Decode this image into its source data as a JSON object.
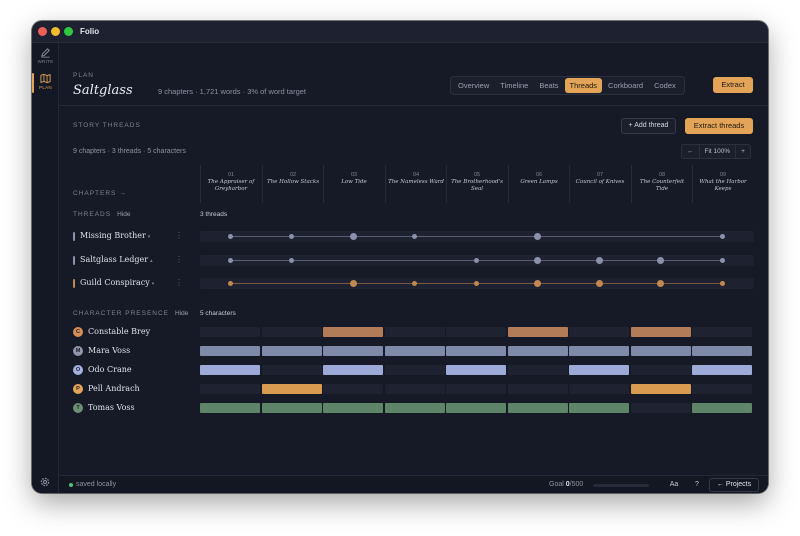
{
  "app": {
    "title": "Folio"
  },
  "rail": {
    "items": [
      {
        "label": "WRITE",
        "icon": "pencil-icon"
      },
      {
        "label": "PLAN",
        "icon": "map-icon"
      }
    ],
    "settings_icon": "gear-icon"
  },
  "header": {
    "section": "PLAN",
    "project": "Saltglass",
    "meta": "9 chapters · 1,721 words · 3% of word target",
    "tabs": [
      "Overview",
      "Timeline",
      "Beats",
      "Threads",
      "Corkboard",
      "Codex"
    ],
    "active_tab": "Threads",
    "extract_label": "Extract"
  },
  "threads_view": {
    "section_title": "STORY THREADS",
    "add_thread_label": "+ Add thread",
    "extract_threads_label": "Extract threads",
    "summary": "9 chapters · 3 threads · 5 characters",
    "zoom": {
      "prev": "←",
      "label": "Fit 100%",
      "next": "+"
    },
    "chapters_label": "CHAPTERS →",
    "chapters": [
      {
        "num": "01",
        "title": "The Appraiser of Greyharbor"
      },
      {
        "num": "02",
        "title": "The Hollow Stacks"
      },
      {
        "num": "03",
        "title": "Low Tide"
      },
      {
        "num": "04",
        "title": "The Nameless Ward"
      },
      {
        "num": "05",
        "title": "The Brotherhood's Seal"
      },
      {
        "num": "06",
        "title": "Green Lamps"
      },
      {
        "num": "07",
        "title": "Council of Knives"
      },
      {
        "num": "08",
        "title": "The Counterfeit Tide"
      },
      {
        "num": "09",
        "title": "What the Harbor Keeps"
      }
    ],
    "threads_label": "THREADS",
    "threads_hide": "Hide",
    "threads_count": "3 threads",
    "threads": [
      {
        "name": "Missing Brother",
        "caret": "▾",
        "more": "⋮",
        "color": "#8a91ab",
        "appearances": [
          0,
          1,
          2,
          3,
          5,
          8
        ],
        "major": [
          2,
          5
        ]
      },
      {
        "name": "Saltglass Ledger",
        "caret": "▴",
        "more": "⋮",
        "color": "#8a91ab",
        "appearances": [
          0,
          1,
          4,
          5,
          6,
          7,
          8
        ],
        "major": [
          5,
          6,
          7
        ]
      },
      {
        "name": "Guild Conspiracy",
        "caret": "▾",
        "more": "⋮",
        "color": "#c2884f",
        "appearances": [
          0,
          2,
          3,
          4,
          5,
          6,
          7,
          8
        ],
        "major": [
          2,
          5,
          6,
          7
        ]
      }
    ],
    "characters_label": "CHARACTER PRESENCE",
    "characters_hide": "Hide",
    "characters_count": "5 characters",
    "characters": [
      {
        "initial": "C",
        "name": "Constable Brey",
        "avatar_color": "#d88e57",
        "bar_color": "#b27c58",
        "present": [
          2,
          5,
          7
        ]
      },
      {
        "initial": "M",
        "name": "Mara Voss",
        "avatar_color": "#8e95ad",
        "bar_color": "#7f89a8",
        "present": [
          0,
          1,
          2,
          3,
          4,
          5,
          6,
          7,
          8
        ]
      },
      {
        "initial": "O",
        "name": "Odo Crane",
        "avatar_color": "#a6b1dd",
        "bar_color": "#9da9d6",
        "present": [
          0,
          2,
          4,
          6,
          8
        ]
      },
      {
        "initial": "P",
        "name": "Pell Andrach",
        "avatar_color": "#e3a457",
        "bar_color": "#d99b4f",
        "present": [
          1,
          7
        ]
      },
      {
        "initial": "T",
        "name": "Tomas Voss",
        "avatar_color": "#6c9073",
        "bar_color": "#5f8568",
        "present": [
          0,
          1,
          2,
          3,
          4,
          5,
          6,
          8
        ]
      }
    ]
  },
  "status": {
    "saved": "saved locally",
    "goal_label": "Goal",
    "goal_current": "0",
    "goal_total": "/500",
    "goal_progress": 0.0,
    "font_button": "Aa",
    "help_button": "?",
    "projects_button": "← Projects"
  }
}
